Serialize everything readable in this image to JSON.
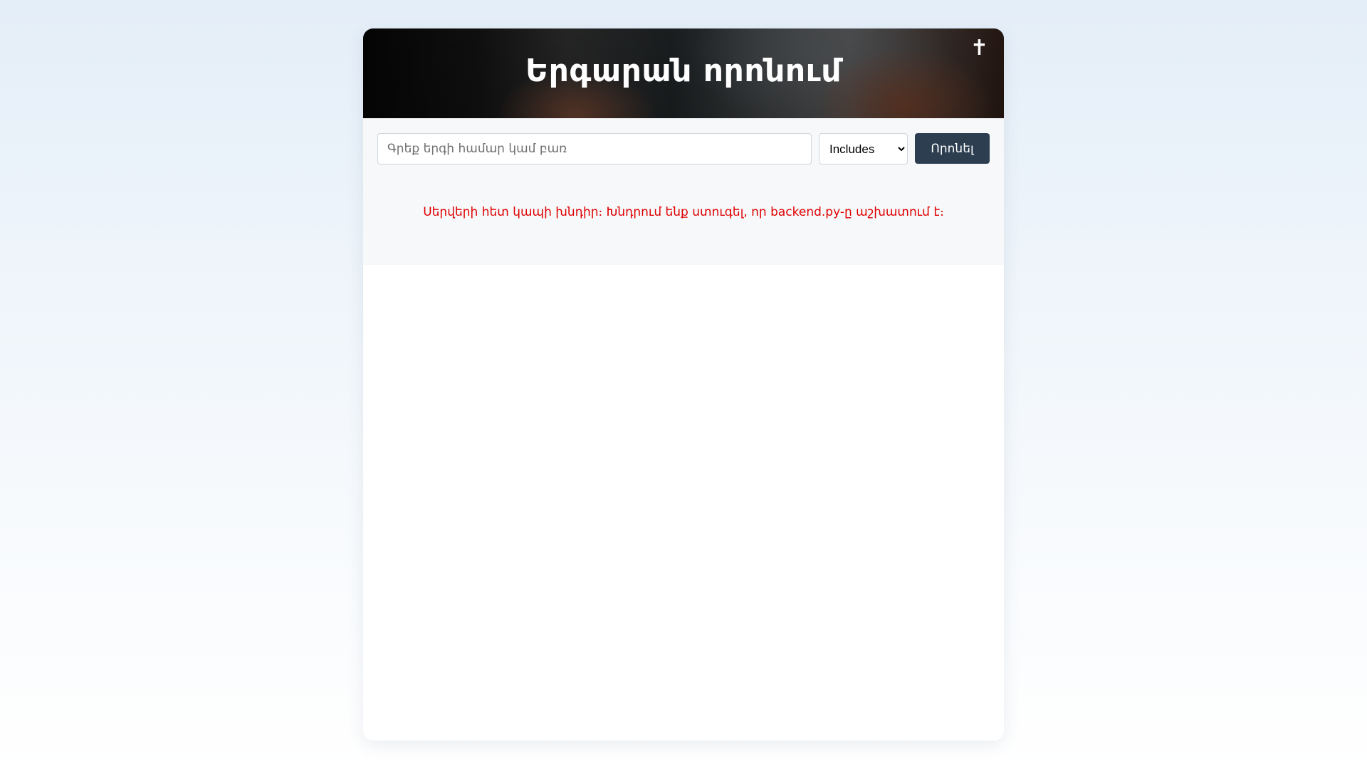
{
  "header": {
    "title": "Երգարան որոնում",
    "cross_glyph": "✝"
  },
  "search": {
    "placeholder": "Գրեք երգի համար կամ բառ",
    "value": "",
    "mode_selected": "Includes",
    "button_label": "Որոնել"
  },
  "status": {
    "error_message": "Սերվերի հետ կապի խնդիր։ Խնդրում ենք ստուգել, որ backend.py-ը աշխատում է։",
    "error_color": "#e00000"
  },
  "colors": {
    "button_bg": "#2c3e50",
    "card_bg": "#ffffff",
    "search_area_bg": "#f6f8fa"
  }
}
